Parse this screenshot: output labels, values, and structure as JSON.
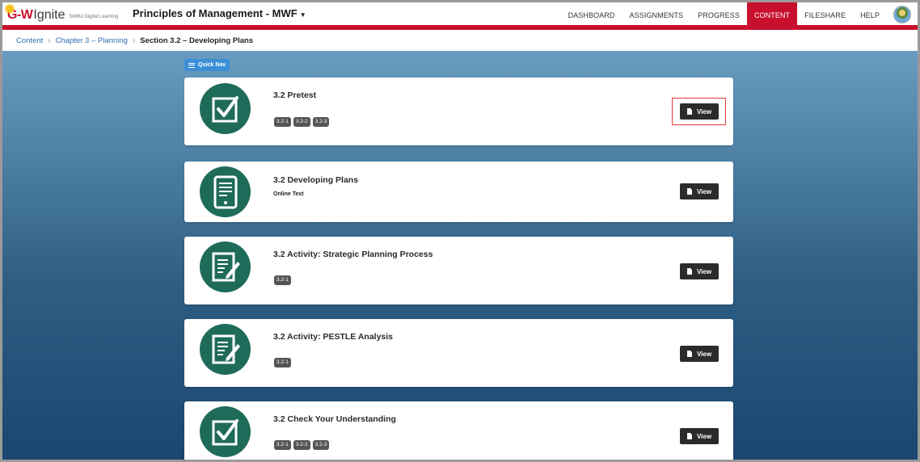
{
  "brand": {
    "logo_mark": "G-W",
    "logo_word": "Ignite",
    "tagline": "Skillful Digital Learning"
  },
  "course": {
    "title": "Principles of Management - MWF"
  },
  "nav": [
    {
      "id": "dashboard",
      "label": "DASHBOARD",
      "active": false
    },
    {
      "id": "assignments",
      "label": "ASSIGNMENTS",
      "active": false
    },
    {
      "id": "progress",
      "label": "PROGRESS",
      "active": false
    },
    {
      "id": "content",
      "label": "CONTENT",
      "active": true
    },
    {
      "id": "fileshare",
      "label": "FILESHARE",
      "active": false
    },
    {
      "id": "help",
      "label": "HELP",
      "active": false
    }
  ],
  "breadcrumb": {
    "content": "Content",
    "chapter": "Chapter 3 – Planning",
    "current": "Section 3.2 – Developing Plans"
  },
  "quicknav": {
    "label": "Quick Nav"
  },
  "items": [
    {
      "title": "3.2 Pretest",
      "subtitle": "",
      "tags": [
        "3.2-1",
        "3.2-2",
        "3.2-3"
      ],
      "icon": "checkbox-icon",
      "view_label": "View"
    },
    {
      "title": "3.2 Developing Plans",
      "subtitle": "Online Text",
      "tags": [],
      "icon": "tablet-icon",
      "view_label": "View"
    },
    {
      "title": "3.2 Activity: Strategic Planning Process",
      "subtitle": "",
      "tags": [
        "3.2-1"
      ],
      "icon": "document-pen-icon",
      "view_label": "View"
    },
    {
      "title": "3.2 Activity: PESTLE Analysis",
      "subtitle": "",
      "tags": [
        "3.2-1"
      ],
      "icon": "document-pen-icon",
      "view_label": "View"
    },
    {
      "title": "3.2 Check Your Understanding",
      "subtitle": "",
      "tags": [
        "3.2-1",
        "3.2-2",
        "3.2-3"
      ],
      "icon": "checkbox-icon",
      "view_label": "View"
    }
  ],
  "colors": {
    "brand_red": "#c8102e",
    "icon_green": "#1f6b5a",
    "link_blue": "#2b6cb0",
    "button_dark": "#2b2b2b"
  }
}
